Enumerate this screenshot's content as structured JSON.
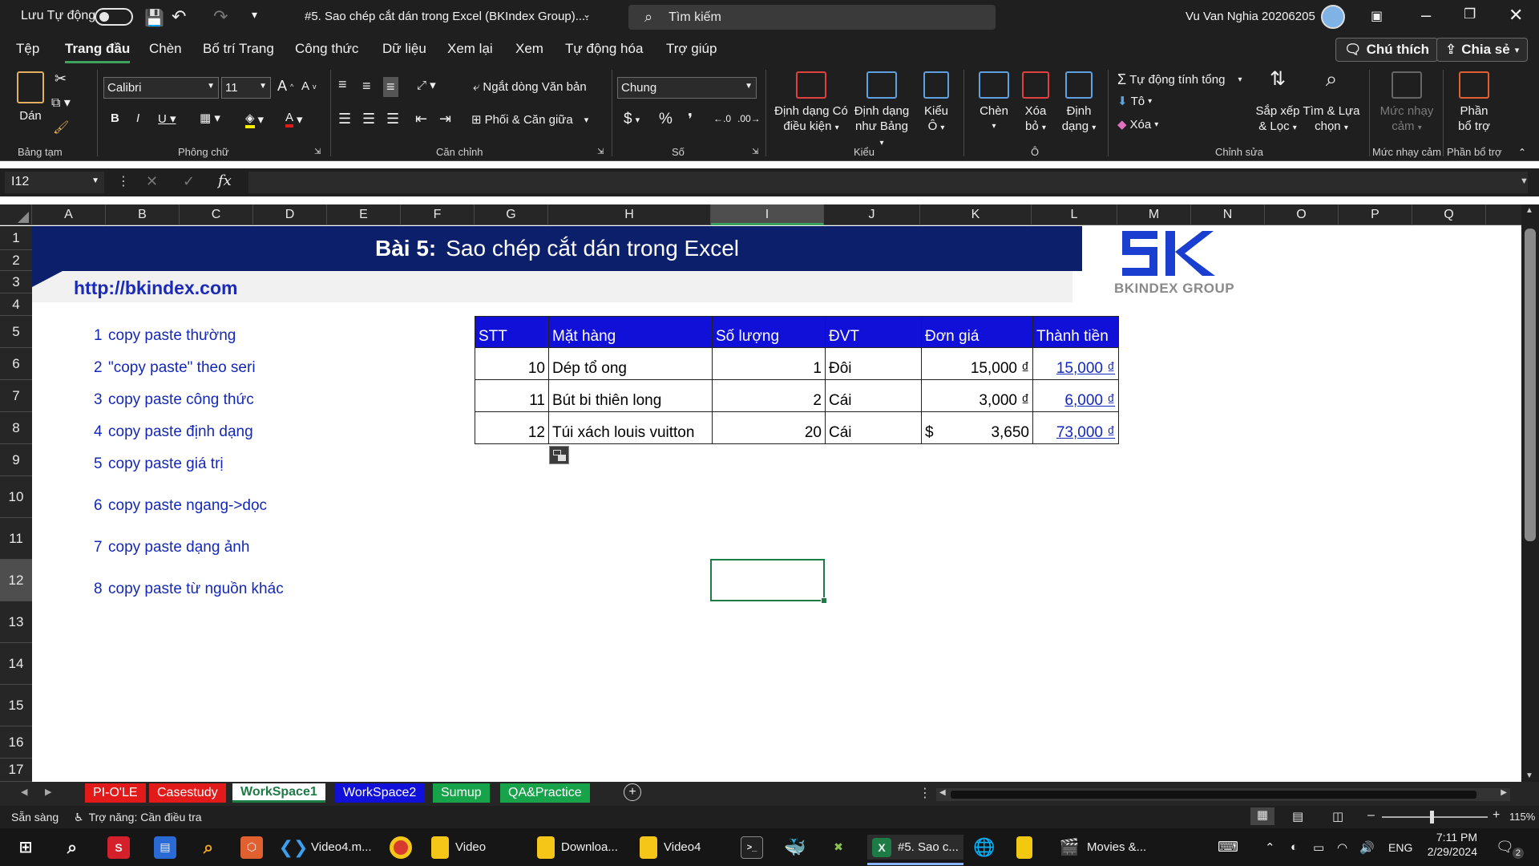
{
  "titlebar": {
    "autosave_label": "Lưu Tự động",
    "doc_title": "#5. Sao chép cắt dán trong Excel (BKIndex Group)....",
    "search_placeholder": "Tìm kiếm",
    "user_name": "Vu Van Nghia 20206205"
  },
  "ribbon_tabs": [
    "Tệp",
    "Trang đầu",
    "Chèn",
    "Bố trí Trang",
    "Công thức",
    "Dữ liệu",
    "Xem lại",
    "Xem",
    "Tự động hóa",
    "Trợ giúp"
  ],
  "ribbon_right": {
    "comment_label": "Chú thích",
    "share_label": "Chia sẻ"
  },
  "ribbon": {
    "paste_label": "Dán",
    "font_name": "Calibri",
    "font_size": "11",
    "wrap_label": "Ngắt dòng Văn bản",
    "merge_label": "Phối & Căn giữa",
    "number_format": "Chung",
    "cond_format_l1": "Định dạng Có",
    "cond_format_l2": "điều kiện",
    "table_format_l1": "Định dạng",
    "table_format_l2": "như Bảng",
    "cell_style_l1": "Kiểu",
    "cell_style_l2": "Ô",
    "insert_label": "Chèn",
    "delete_l1": "Xóa",
    "delete_l2": "bỏ",
    "format_l1": "Định",
    "format_l2": "dạng",
    "autosum_label": "Tự động tính tổng",
    "fill_label": "Tô",
    "clear_label": "Xóa",
    "sort_l1": "Sắp xếp",
    "sort_l2": "& Lọc",
    "find_l1": "Tìm & Lựa",
    "find_l2": "chọn",
    "sensitivity_l1": "Mức nhạy",
    "sensitivity_l2": "cảm",
    "addins_l1": "Phần",
    "addins_l2": "bổ trợ",
    "groups": {
      "clipboard": "Bảng tạm",
      "font": "Phông chữ",
      "alignment": "Căn chỉnh",
      "number": "Số",
      "styles": "Kiểu",
      "cells": "Ô",
      "editing": "Chỉnh sửa",
      "sensitivity": "Mức nhạy cảm",
      "addins": "Phần bổ trợ"
    }
  },
  "formula_bar": {
    "name_box": "I12",
    "fx": "fx",
    "value": ""
  },
  "columns": [
    "A",
    "B",
    "C",
    "D",
    "E",
    "F",
    "G",
    "H",
    "I",
    "J",
    "K",
    "L",
    "M",
    "N",
    "O",
    "P",
    "Q"
  ],
  "rows": [
    "1",
    "2",
    "3",
    "4",
    "5",
    "6",
    "7",
    "8",
    "9",
    "10",
    "11",
    "12",
    "13",
    "14",
    "15",
    "16",
    "17"
  ],
  "selected": {
    "column": "I",
    "row": "12"
  },
  "sheet": {
    "banner_prefix": "Bài 5:",
    "banner_title": "Sao chép cắt dán trong Excel",
    "url": "http://bkindex.com",
    "logo_text": "BKINDEX GROUP",
    "items": [
      {
        "num": "1",
        "text": "copy paste thường"
      },
      {
        "num": "2",
        "text": "\"copy paste\" theo seri"
      },
      {
        "num": "3",
        "text": "copy paste công thức"
      },
      {
        "num": "4",
        "text": "copy paste định dạng"
      },
      {
        "num": "5",
        "text": "copy paste giá trị"
      },
      {
        "num": "6",
        "text": "copy paste ngang->dọc"
      },
      {
        "num": "7",
        "text": "copy paste dạng ảnh"
      },
      {
        "num": "8",
        "text": "copy paste từ nguồn khác"
      }
    ],
    "table": {
      "headers": [
        "STT",
        "Mặt hàng",
        "Số lượng",
        "ĐVT",
        "Đơn giá",
        "Thành tiền"
      ],
      "rows": [
        {
          "stt": "10",
          "item": "Dép tổ ong",
          "qty": "1",
          "unit": "Đôi",
          "price_sym": "",
          "price": "15,000 ₫",
          "total": "15,000 ₫"
        },
        {
          "stt": "11",
          "item": "Bút bi thiên long",
          "qty": "2",
          "unit": "Cái",
          "price_sym": "",
          "price": "3,000 ₫",
          "total": "6,000 ₫"
        },
        {
          "stt": "12",
          "item": "Túi xách louis vuitton",
          "qty": "20",
          "unit": "Cái",
          "price_sym": "$",
          "price": "3,650",
          "total": "73,000 ₫"
        }
      ]
    }
  },
  "sheet_tabs": [
    {
      "label": "PI-O'LE",
      "color": "#e21a1a"
    },
    {
      "label": "Casestudy",
      "color": "#e21a1a"
    },
    {
      "label": "WorkSpace1",
      "color": "#ffffff"
    },
    {
      "label": "WorkSpace2",
      "color": "#1010d8"
    },
    {
      "label": "Sumup",
      "color": "#17a34a"
    },
    {
      "label": "QA&Practice",
      "color": "#17a34a"
    }
  ],
  "status": {
    "ready": "Sẵn sàng",
    "accessibility": "Trợ năng: Cần điều tra",
    "zoom": "115%"
  },
  "taskbar": {
    "apps": [
      "Video4.m...",
      "Video",
      "Downloa...",
      "Video4",
      "#5. Sao c...",
      "Movies &..."
    ],
    "lang": "ENG",
    "time": "7:11 PM",
    "date": "2/29/2024",
    "notif": "2"
  }
}
